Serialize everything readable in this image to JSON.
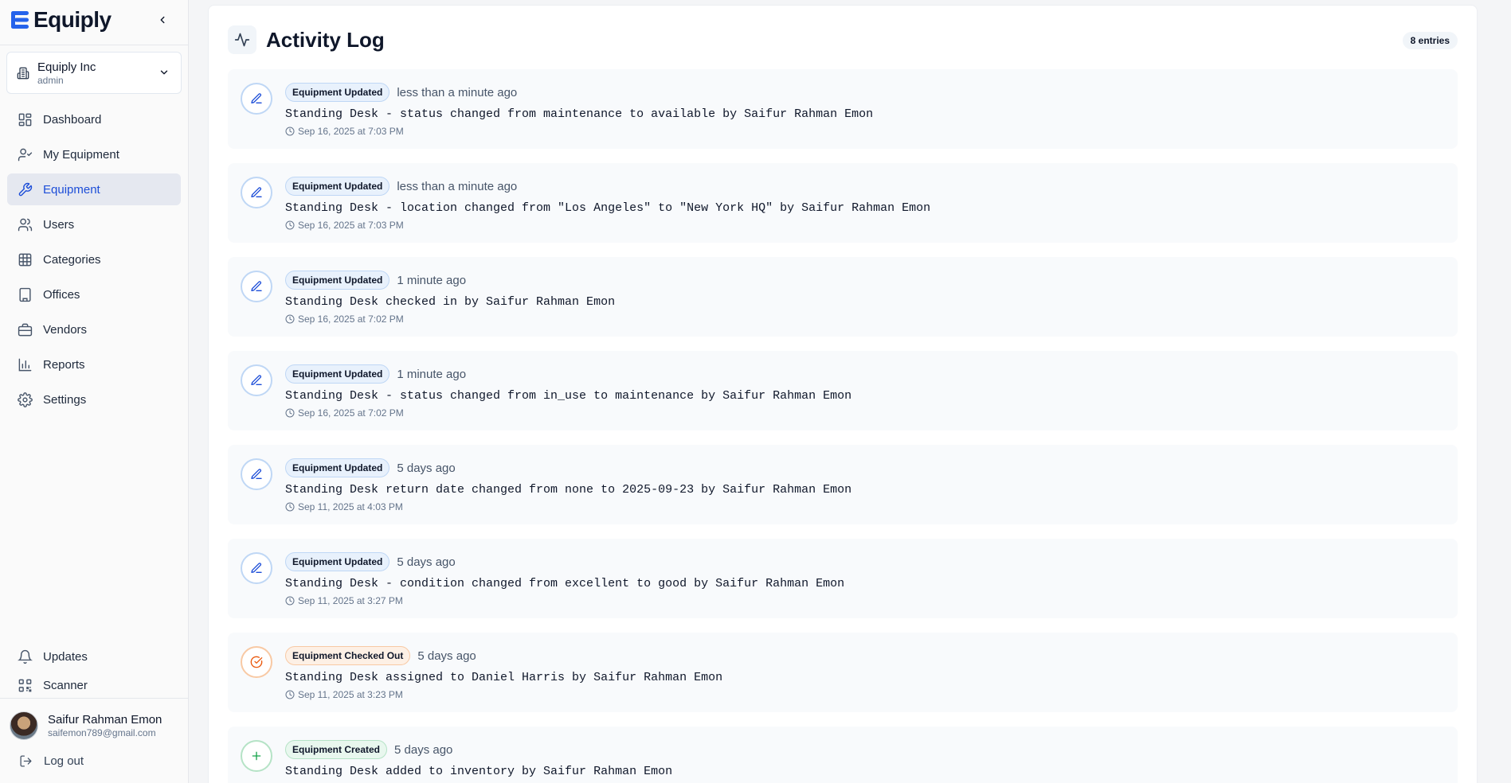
{
  "brand": {
    "name": "Equiply"
  },
  "org": {
    "name": "Equiply Inc",
    "role": "admin"
  },
  "nav": {
    "items": [
      {
        "label": "Dashboard",
        "icon": "dashboard-icon"
      },
      {
        "label": "My Equipment",
        "icon": "user-check-icon"
      },
      {
        "label": "Equipment",
        "icon": "wrench-icon",
        "active": true
      },
      {
        "label": "Users",
        "icon": "users-icon"
      },
      {
        "label": "Categories",
        "icon": "grid-icon"
      },
      {
        "label": "Offices",
        "icon": "building-icon"
      },
      {
        "label": "Vendors",
        "icon": "briefcase-icon"
      },
      {
        "label": "Reports",
        "icon": "bar-chart-icon"
      },
      {
        "label": "Settings",
        "icon": "gear-icon"
      }
    ],
    "bottom": [
      {
        "label": "Updates",
        "icon": "bell-icon"
      },
      {
        "label": "Scanner",
        "icon": "qr-icon"
      }
    ]
  },
  "user": {
    "name": "Saifur Rahman Emon",
    "email": "saifemon789@gmail.com",
    "logout_label": "Log out"
  },
  "page": {
    "title": "Activity Log",
    "entries_badge": "8 entries"
  },
  "colors": {
    "accent": "#1d4ed8",
    "updated": "#bfd7f5",
    "checked_out": "#f8c9a4",
    "created": "#b5e3c6"
  },
  "logs": [
    {
      "type": "Equipment Updated",
      "kind": "blue",
      "icon": "pencil-icon",
      "relative": "less than a minute ago",
      "message": "Standing Desk - status changed from maintenance to available by Saifur Rahman Emon",
      "date": "Sep 16, 2025 at 7:03 PM"
    },
    {
      "type": "Equipment Updated",
      "kind": "blue",
      "icon": "pencil-icon",
      "relative": "less than a minute ago",
      "message": "Standing Desk - location changed from \"Los Angeles\" to \"New York HQ\" by Saifur Rahman Emon",
      "date": "Sep 16, 2025 at 7:03 PM"
    },
    {
      "type": "Equipment Updated",
      "kind": "blue",
      "icon": "pencil-icon",
      "relative": "1 minute ago",
      "message": "Standing Desk checked in by Saifur Rahman Emon",
      "date": "Sep 16, 2025 at 7:02 PM"
    },
    {
      "type": "Equipment Updated",
      "kind": "blue",
      "icon": "pencil-icon",
      "relative": "1 minute ago",
      "message": "Standing Desk - status changed from in_use to maintenance by Saifur Rahman Emon",
      "date": "Sep 16, 2025 at 7:02 PM"
    },
    {
      "type": "Equipment Updated",
      "kind": "blue",
      "icon": "pencil-icon",
      "relative": "5 days ago",
      "message": "Standing Desk return date changed from none to 2025-09-23 by Saifur Rahman Emon",
      "date": "Sep 11, 2025 at 4:03 PM"
    },
    {
      "type": "Equipment Updated",
      "kind": "blue",
      "icon": "pencil-icon",
      "relative": "5 days ago",
      "message": "Standing Desk - condition changed from excellent to good by Saifur Rahman Emon",
      "date": "Sep 11, 2025 at 3:27 PM"
    },
    {
      "type": "Equipment Checked Out",
      "kind": "orange",
      "icon": "check-circle-icon",
      "relative": "5 days ago",
      "message": "Standing Desk assigned to Daniel Harris by Saifur Rahman Emon",
      "date": "Sep 11, 2025 at 3:23 PM"
    },
    {
      "type": "Equipment Created",
      "kind": "green",
      "icon": "plus-icon",
      "relative": "5 days ago",
      "message": "Standing Desk added to inventory by Saifur Rahman Emon",
      "date": ""
    }
  ]
}
